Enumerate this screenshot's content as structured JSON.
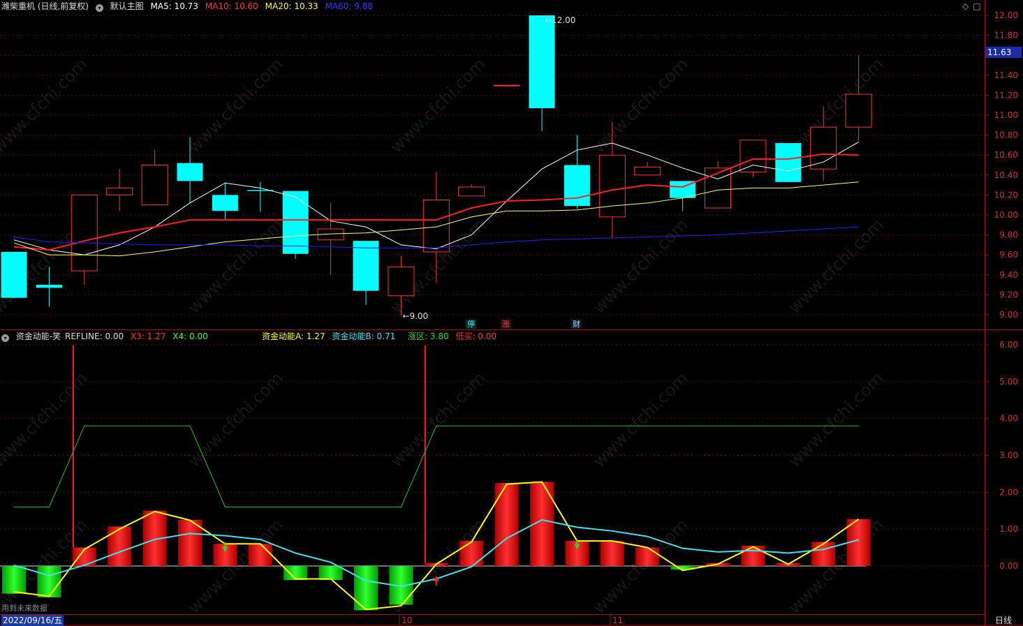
{
  "header_main": {
    "title": "潍柴重机 (日线,前复权)",
    "template": "默认主图",
    "ma5": "MA5: 10.73",
    "ma10": "MA10: 10.60",
    "ma20": "MA20: 10.33",
    "ma60": "MA60: 9.88"
  },
  "header_sub": {
    "title": "资金动能-笑",
    "refline": "REFLINE: 0.00",
    "x3": "X3: 1.27",
    "x4": "X4: 0.00",
    "a": "资金动能A: 1.27",
    "b": "资金动能B: 0.71",
    "zone": "涨区: 3.80",
    "buy": "低买: 0.00"
  },
  "labels": {
    "high_mark": "12.00",
    "low_mark": "9.00",
    "current_price": "11.63",
    "event_1": "停",
    "event_2": "涨",
    "event_3": "财",
    "footer_note": "用到未来数据",
    "date_cursor": "2022/09/16/五",
    "month_10": "10",
    "month_11": "11",
    "period": "日线",
    "watermark": "www.cfchi.com"
  },
  "colors": {
    "up": "#ff3232",
    "down": "#00ffff",
    "ma5": "#ffffff",
    "ma10": "#ff2020",
    "ma20": "#ffff60",
    "ma60": "#2020ff",
    "bar_up": "#ff1010",
    "bar_down": "#10e010",
    "line_a": "#ffff00",
    "line_b": "#40e0f0",
    "zone": "#20c020",
    "signal": "#ff2020"
  },
  "chart_data": [
    {
      "type": "candlestick",
      "ylim": [
        9.0,
        12.0
      ],
      "yticks": [
        "12.00",
        "11.80",
        "11.60",
        "11.40",
        "11.20",
        "11.00",
        "10.80",
        "10.60",
        "10.40",
        "10.20",
        "10.00",
        "9.80",
        "9.60",
        "9.40",
        "9.20",
        "9.00"
      ],
      "candles": [
        {
          "o": 9.63,
          "h": 9.63,
          "l": 9.17,
          "c": 9.17
        },
        {
          "o": 9.3,
          "h": 9.48,
          "l": 9.08,
          "c": 9.27
        },
        {
          "o": 9.44,
          "h": 10.0,
          "l": 9.3,
          "c": 10.2
        },
        {
          "o": 10.2,
          "h": 10.46,
          "l": 10.04,
          "c": 10.27
        },
        {
          "o": 10.1,
          "h": 10.65,
          "l": 10.1,
          "c": 10.5
        },
        {
          "o": 10.52,
          "h": 10.78,
          "l": 10.12,
          "c": 10.34
        },
        {
          "o": 10.2,
          "h": 10.32,
          "l": 9.96,
          "c": 10.04
        },
        {
          "o": 10.25,
          "h": 10.33,
          "l": 10.03,
          "c": 10.24
        },
        {
          "o": 10.24,
          "h": 10.24,
          "l": 9.56,
          "c": 9.61
        },
        {
          "o": 9.75,
          "h": 10.12,
          "l": 9.4,
          "c": 9.86
        },
        {
          "o": 9.74,
          "h": 9.74,
          "l": 9.1,
          "c": 9.24
        },
        {
          "o": 9.19,
          "h": 9.59,
          "l": 8.99,
          "c": 9.48
        },
        {
          "o": 9.63,
          "h": 10.43,
          "l": 9.32,
          "c": 10.15
        },
        {
          "o": 10.19,
          "h": 10.31,
          "l": 10.19,
          "c": 10.28
        },
        {
          "o": 11.3,
          "h": 11.3,
          "l": 11.3,
          "c": 11.3
        },
        {
          "o": 12.0,
          "h": 12.0,
          "l": 10.84,
          "c": 11.07
        },
        {
          "o": 10.5,
          "h": 10.8,
          "l": 10.06,
          "c": 10.09
        },
        {
          "o": 9.98,
          "h": 10.93,
          "l": 9.77,
          "c": 10.6
        },
        {
          "o": 10.4,
          "h": 10.53,
          "l": 10.4,
          "c": 10.48
        },
        {
          "o": 10.34,
          "h": 10.34,
          "l": 10.04,
          "c": 10.17
        },
        {
          "o": 10.07,
          "h": 10.54,
          "l": 10.07,
          "c": 10.47
        },
        {
          "o": 10.43,
          "h": 10.75,
          "l": 10.38,
          "c": 10.75
        },
        {
          "o": 10.72,
          "h": 10.72,
          "l": 10.33,
          "c": 10.33
        },
        {
          "o": 10.46,
          "h": 11.09,
          "l": 10.34,
          "c": 10.88
        },
        {
          "o": 10.88,
          "h": 11.6,
          "l": 10.74,
          "c": 11.21
        }
      ],
      "series": [
        {
          "name": "MA5",
          "values": [
            9.75,
            9.65,
            9.6,
            9.7,
            9.88,
            10.12,
            10.32,
            10.27,
            10.18,
            9.94,
            9.88,
            9.7,
            9.66,
            9.8,
            10.14,
            10.46,
            10.65,
            10.72,
            10.6,
            10.47,
            10.36,
            10.5,
            10.44,
            10.53,
            10.73
          ]
        },
        {
          "name": "MA10",
          "values": [
            9.68,
            9.65,
            9.74,
            9.82,
            9.88,
            9.95,
            9.95,
            9.95,
            9.95,
            9.95,
            9.95,
            9.95,
            9.95,
            10.07,
            10.14,
            10.15,
            10.17,
            10.25,
            10.3,
            10.28,
            10.42,
            10.56,
            10.56,
            10.61,
            10.6
          ]
        },
        {
          "name": "MA20",
          "values": [
            9.72,
            9.6,
            9.6,
            9.59,
            9.63,
            9.68,
            9.73,
            9.76,
            9.79,
            9.81,
            9.82,
            9.85,
            9.88,
            9.98,
            10.04,
            10.04,
            10.05,
            10.09,
            10.12,
            10.17,
            10.25,
            10.27,
            10.27,
            10.3,
            10.33
          ]
        },
        {
          "name": "MA60",
          "values": [
            9.78,
            9.73,
            9.72,
            9.71,
            9.7,
            9.7,
            9.7,
            9.69,
            9.69,
            9.68,
            9.67,
            9.67,
            9.67,
            9.7,
            9.73,
            9.75,
            9.76,
            9.77,
            9.78,
            9.79,
            9.8,
            9.82,
            9.84,
            9.86,
            9.88
          ]
        }
      ]
    },
    {
      "type": "bar",
      "ylim": [
        -1.3,
        6.2
      ],
      "yticks": [
        "6.00",
        "5.00",
        "4.00",
        "3.00",
        "2.00",
        "1.00",
        "0.00"
      ],
      "values": [
        -0.75,
        -0.85,
        0.5,
        1.07,
        1.5,
        1.25,
        0.6,
        0.6,
        -0.38,
        -0.38,
        -1.2,
        -1.05,
        0.08,
        0.68,
        2.25,
        2.28,
        0.68,
        0.68,
        0.5,
        -0.1,
        0.08,
        0.55,
        0.08,
        0.65,
        1.27
      ],
      "series": [
        {
          "name": "资金动能A",
          "values": [
            -0.7,
            -0.82,
            0.45,
            1.0,
            1.48,
            1.24,
            0.6,
            0.6,
            -0.35,
            -0.35,
            -1.18,
            -1.08,
            0.05,
            0.65,
            2.22,
            2.28,
            0.68,
            0.68,
            0.5,
            -0.12,
            0.05,
            0.52,
            0.05,
            0.6,
            1.27
          ]
        },
        {
          "name": "资金动能B",
          "values": [
            0.02,
            -0.26,
            0.02,
            0.38,
            0.72,
            0.88,
            0.82,
            0.72,
            0.35,
            0.1,
            -0.4,
            -0.55,
            -0.35,
            -0.02,
            0.75,
            1.25,
            1.05,
            0.95,
            0.8,
            0.48,
            0.38,
            0.42,
            0.35,
            0.45,
            0.71
          ]
        },
        {
          "name": "涨区",
          "values": [
            1.6,
            1.6,
            3.8,
            3.8,
            3.8,
            3.8,
            1.6,
            1.6,
            1.6,
            1.6,
            1.6,
            1.6,
            3.8,
            3.8,
            3.8,
            3.8,
            3.8,
            3.8,
            3.8,
            3.8,
            3.8,
            3.8,
            3.8,
            3.8,
            3.8
          ]
        }
      ],
      "signals_up": [
        2,
        12
      ],
      "arrows_down": [
        6,
        16
      ],
      "arrows_up": [
        12
      ]
    }
  ]
}
